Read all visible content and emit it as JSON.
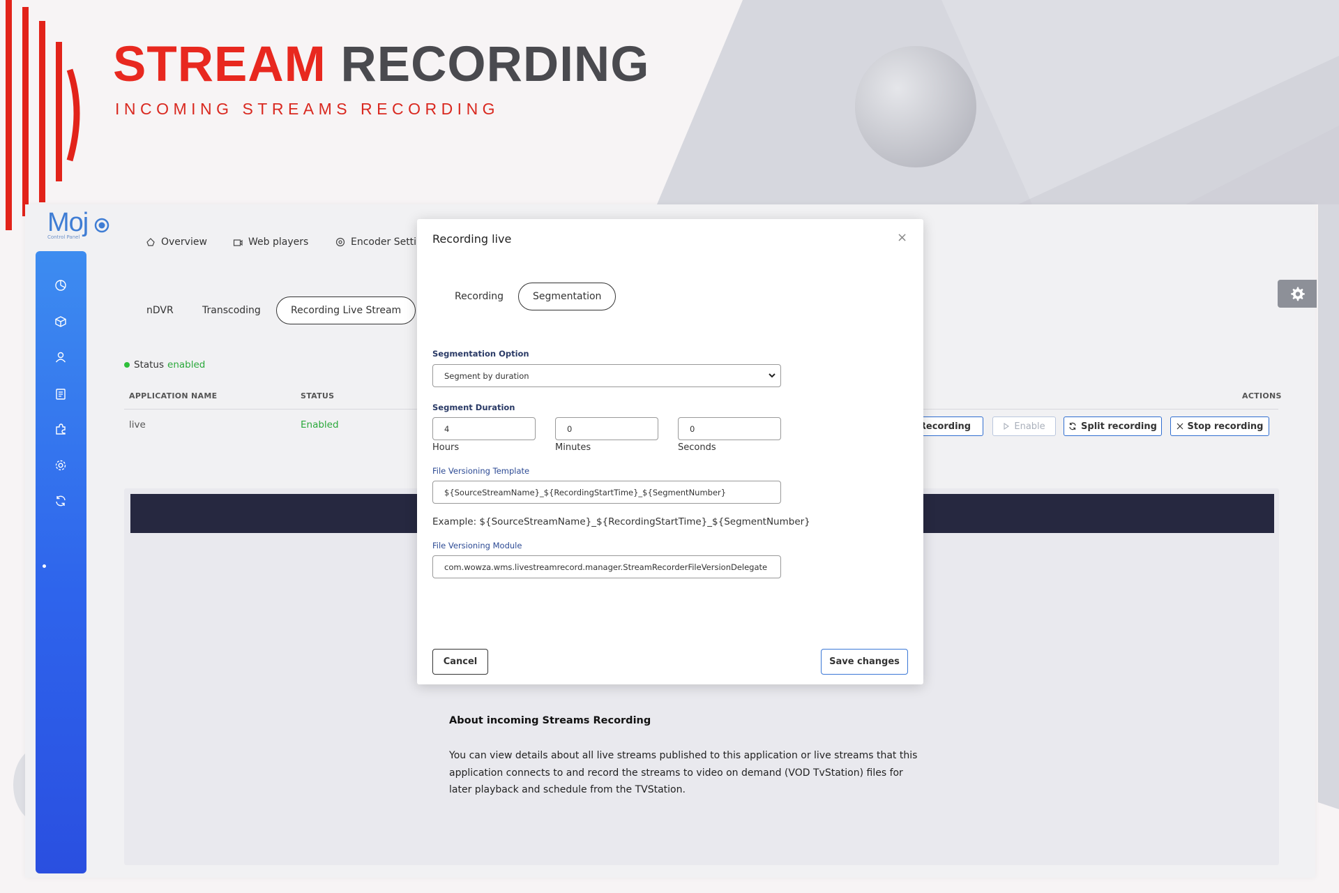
{
  "hero": {
    "title_word1": "STREAM",
    "title_word2": "RECORDING",
    "subtitle": "INCOMING STREAMS RECORDING",
    "colors": {
      "red": "#e8281f",
      "dark": "#4a4a4f"
    }
  },
  "logo": {
    "text": "Moj",
    "sub": "Control Panel"
  },
  "sidebar": {
    "items": [
      {
        "icon": "pie-chart-icon"
      },
      {
        "icon": "cube-icon",
        "active": true
      },
      {
        "icon": "user-icon"
      },
      {
        "icon": "clipboard-icon"
      },
      {
        "icon": "puzzle-icon"
      },
      {
        "icon": "gear-icon"
      },
      {
        "icon": "refresh-icon"
      }
    ],
    "color": "#2f66ec"
  },
  "topnav": {
    "overview": "Overview",
    "web_players": "Web players",
    "encoder_settings": "Encoder Setting"
  },
  "subtabs": {
    "ndvr": "nDVR",
    "transcoding": "Transcoding",
    "recording_live_stream": "Recording Live Stream"
  },
  "status": {
    "label": "Status",
    "value": "enabled"
  },
  "table": {
    "headers": {
      "application_name": "APPLICATION NAME",
      "status": "STATUS",
      "actions": "ACTIONS"
    },
    "row": {
      "application_name": "live",
      "status": "Enabled"
    }
  },
  "actions": {
    "recording": "Recording",
    "enable": "Enable",
    "split_recording": "Split recording",
    "stop_recording": "Stop recording"
  },
  "about": {
    "title": "About incoming Streams Recording",
    "text": "You can view details about all live streams published to this application or live streams that this application connects to and record the streams to video on demand (VOD TvStation) files for later playback and schedule from the TVStation."
  },
  "modal": {
    "title": "Recording live",
    "close": "×",
    "tabs": {
      "recording": "Recording",
      "segmentation": "Segmentation"
    },
    "segmentation_option_label": "Segmentation Option",
    "segmentation_option_value": "Segment by duration",
    "segment_duration_label": "Segment Duration",
    "hours_value": "4",
    "minutes_value": "0",
    "seconds_value": "0",
    "hours_label": "Hours",
    "minutes_label": "Minutes",
    "seconds_label": "Seconds",
    "file_versioning_template_label": "File Versioning Template",
    "file_versioning_template_value": "${SourceStreamName}_${RecordingStartTime}_${SegmentNumber}",
    "example": "Example: ${SourceStreamName}_${RecordingStartTime}_${SegmentNumber}",
    "file_versioning_module_label": "File Versioning Module",
    "file_versioning_module_value": "com.wowza.wms.livestreamrecord.manager.StreamRecorderFileVersionDelegate",
    "cancel": "Cancel",
    "save": "Save changes"
  }
}
